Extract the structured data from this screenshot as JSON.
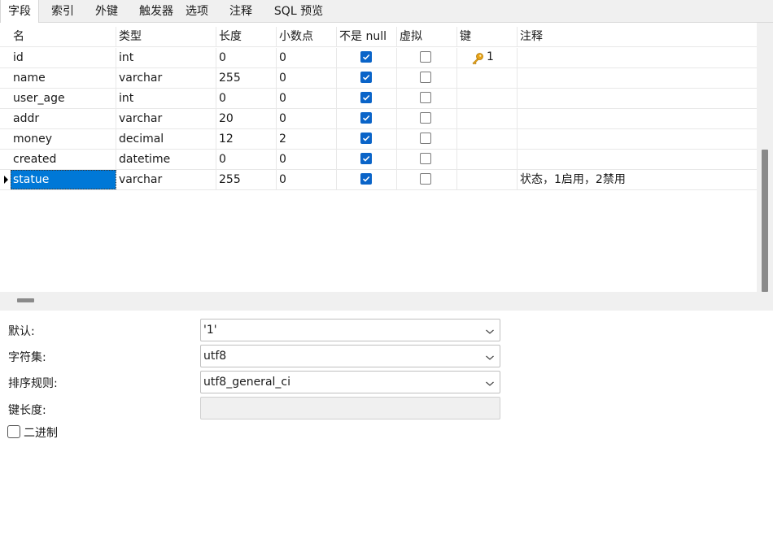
{
  "tabs": [
    {
      "label": "字段",
      "active": true
    },
    {
      "label": "索引"
    },
    {
      "label": "外键"
    },
    {
      "label": "触发器"
    },
    {
      "label": "选项"
    },
    {
      "label": "注释"
    },
    {
      "label": "SQL 预览"
    }
  ],
  "grid": {
    "headers": [
      "名",
      "类型",
      "长度",
      "小数点",
      "不是 null",
      "虚拟",
      "键",
      "注释"
    ],
    "rows": [
      {
        "name": "id",
        "type": "int",
        "length": "0",
        "decimals": "0",
        "not_null": true,
        "virtual": false,
        "key": "1",
        "comment": ""
      },
      {
        "name": "name",
        "type": "varchar",
        "length": "255",
        "decimals": "0",
        "not_null": true,
        "virtual": false,
        "key": "",
        "comment": ""
      },
      {
        "name": "user_age",
        "type": "int",
        "length": "0",
        "decimals": "0",
        "not_null": true,
        "virtual": false,
        "key": "",
        "comment": ""
      },
      {
        "name": "addr",
        "type": "varchar",
        "length": "20",
        "decimals": "0",
        "not_null": true,
        "virtual": false,
        "key": "",
        "comment": ""
      },
      {
        "name": "money",
        "type": "decimal",
        "length": "12",
        "decimals": "2",
        "not_null": true,
        "virtual": false,
        "key": "",
        "comment": ""
      },
      {
        "name": "created",
        "type": "datetime",
        "length": "0",
        "decimals": "0",
        "not_null": true,
        "virtual": false,
        "key": "",
        "comment": ""
      },
      {
        "name": "statue",
        "type": "varchar",
        "length": "255",
        "decimals": "0",
        "not_null": true,
        "virtual": false,
        "key": "",
        "comment": "状态，1启用，2禁用",
        "selected": true
      }
    ],
    "key_icon": "key-icon"
  },
  "properties": {
    "default_label": "默认:",
    "default_value": "'1'",
    "charset_label": "字符集:",
    "charset_value": "utf8",
    "collation_label": "排序规则:",
    "collation_value": "utf8_general_ci",
    "keylen_label": "键长度:",
    "keylen_value": "",
    "binary_label": "二进制",
    "binary_checked": false
  },
  "colors": {
    "selection": "#0078d7",
    "checkbox_checked": "#0a64c8",
    "key_icon": "#e8a317"
  }
}
